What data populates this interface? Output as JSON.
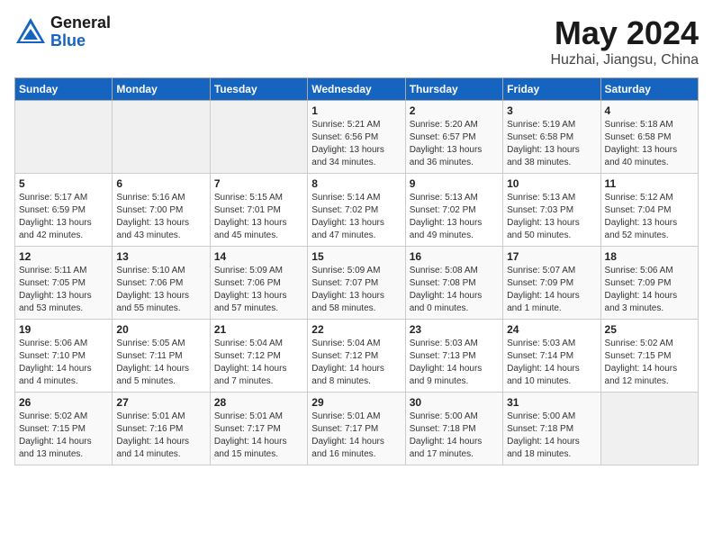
{
  "header": {
    "logo_general": "General",
    "logo_blue": "Blue",
    "title": "May 2024",
    "location": "Huzhai, Jiangsu, China"
  },
  "weekdays": [
    "Sunday",
    "Monday",
    "Tuesday",
    "Wednesday",
    "Thursday",
    "Friday",
    "Saturday"
  ],
  "weeks": [
    [
      {
        "day": "",
        "empty": true
      },
      {
        "day": "",
        "empty": true
      },
      {
        "day": "",
        "empty": true
      },
      {
        "day": "1",
        "sunrise": "5:21 AM",
        "sunset": "6:56 PM",
        "daylight": "13 hours and 34 minutes."
      },
      {
        "day": "2",
        "sunrise": "5:20 AM",
        "sunset": "6:57 PM",
        "daylight": "13 hours and 36 minutes."
      },
      {
        "day": "3",
        "sunrise": "5:19 AM",
        "sunset": "6:58 PM",
        "daylight": "13 hours and 38 minutes."
      },
      {
        "day": "4",
        "sunrise": "5:18 AM",
        "sunset": "6:58 PM",
        "daylight": "13 hours and 40 minutes."
      }
    ],
    [
      {
        "day": "5",
        "sunrise": "5:17 AM",
        "sunset": "6:59 PM",
        "daylight": "13 hours and 42 minutes."
      },
      {
        "day": "6",
        "sunrise": "5:16 AM",
        "sunset": "7:00 PM",
        "daylight": "13 hours and 43 minutes."
      },
      {
        "day": "7",
        "sunrise": "5:15 AM",
        "sunset": "7:01 PM",
        "daylight": "13 hours and 45 minutes."
      },
      {
        "day": "8",
        "sunrise": "5:14 AM",
        "sunset": "7:02 PM",
        "daylight": "13 hours and 47 minutes."
      },
      {
        "day": "9",
        "sunrise": "5:13 AM",
        "sunset": "7:02 PM",
        "daylight": "13 hours and 49 minutes."
      },
      {
        "day": "10",
        "sunrise": "5:13 AM",
        "sunset": "7:03 PM",
        "daylight": "13 hours and 50 minutes."
      },
      {
        "day": "11",
        "sunrise": "5:12 AM",
        "sunset": "7:04 PM",
        "daylight": "13 hours and 52 minutes."
      }
    ],
    [
      {
        "day": "12",
        "sunrise": "5:11 AM",
        "sunset": "7:05 PM",
        "daylight": "13 hours and 53 minutes."
      },
      {
        "day": "13",
        "sunrise": "5:10 AM",
        "sunset": "7:06 PM",
        "daylight": "13 hours and 55 minutes."
      },
      {
        "day": "14",
        "sunrise": "5:09 AM",
        "sunset": "7:06 PM",
        "daylight": "13 hours and 57 minutes."
      },
      {
        "day": "15",
        "sunrise": "5:09 AM",
        "sunset": "7:07 PM",
        "daylight": "13 hours and 58 minutes."
      },
      {
        "day": "16",
        "sunrise": "5:08 AM",
        "sunset": "7:08 PM",
        "daylight": "14 hours and 0 minutes."
      },
      {
        "day": "17",
        "sunrise": "5:07 AM",
        "sunset": "7:09 PM",
        "daylight": "14 hours and 1 minute."
      },
      {
        "day": "18",
        "sunrise": "5:06 AM",
        "sunset": "7:09 PM",
        "daylight": "14 hours and 3 minutes."
      }
    ],
    [
      {
        "day": "19",
        "sunrise": "5:06 AM",
        "sunset": "7:10 PM",
        "daylight": "14 hours and 4 minutes."
      },
      {
        "day": "20",
        "sunrise": "5:05 AM",
        "sunset": "7:11 PM",
        "daylight": "14 hours and 5 minutes."
      },
      {
        "day": "21",
        "sunrise": "5:04 AM",
        "sunset": "7:12 PM",
        "daylight": "14 hours and 7 minutes."
      },
      {
        "day": "22",
        "sunrise": "5:04 AM",
        "sunset": "7:12 PM",
        "daylight": "14 hours and 8 minutes."
      },
      {
        "day": "23",
        "sunrise": "5:03 AM",
        "sunset": "7:13 PM",
        "daylight": "14 hours and 9 minutes."
      },
      {
        "day": "24",
        "sunrise": "5:03 AM",
        "sunset": "7:14 PM",
        "daylight": "14 hours and 10 minutes."
      },
      {
        "day": "25",
        "sunrise": "5:02 AM",
        "sunset": "7:15 PM",
        "daylight": "14 hours and 12 minutes."
      }
    ],
    [
      {
        "day": "26",
        "sunrise": "5:02 AM",
        "sunset": "7:15 PM",
        "daylight": "14 hours and 13 minutes."
      },
      {
        "day": "27",
        "sunrise": "5:01 AM",
        "sunset": "7:16 PM",
        "daylight": "14 hours and 14 minutes."
      },
      {
        "day": "28",
        "sunrise": "5:01 AM",
        "sunset": "7:17 PM",
        "daylight": "14 hours and 15 minutes."
      },
      {
        "day": "29",
        "sunrise": "5:01 AM",
        "sunset": "7:17 PM",
        "daylight": "14 hours and 16 minutes."
      },
      {
        "day": "30",
        "sunrise": "5:00 AM",
        "sunset": "7:18 PM",
        "daylight": "14 hours and 17 minutes."
      },
      {
        "day": "31",
        "sunrise": "5:00 AM",
        "sunset": "7:18 PM",
        "daylight": "14 hours and 18 minutes."
      },
      {
        "day": "",
        "empty": true
      }
    ]
  ]
}
